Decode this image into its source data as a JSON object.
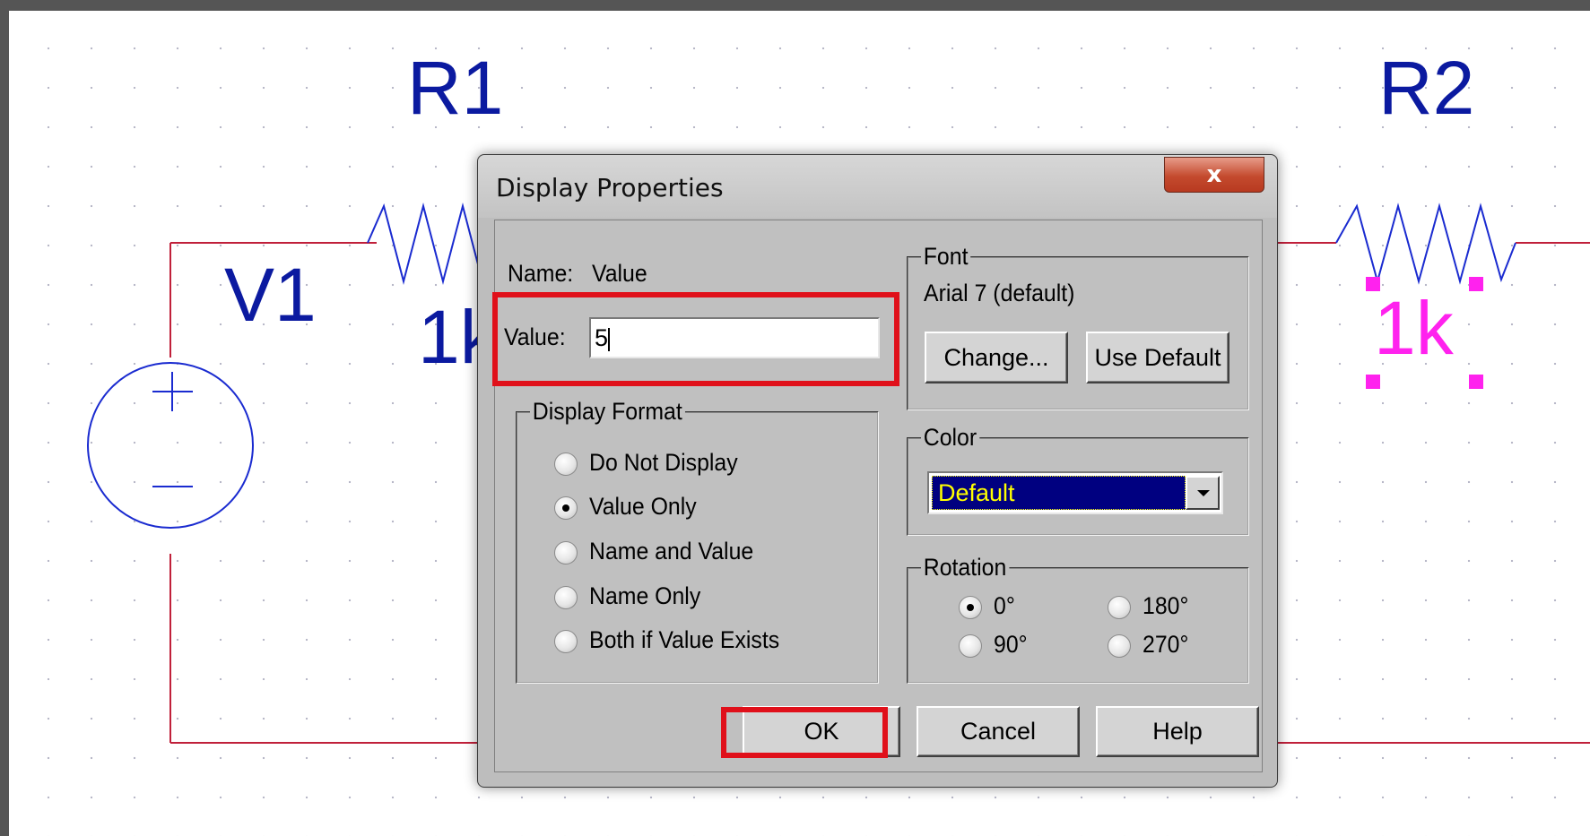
{
  "schematic": {
    "labels": {
      "r1": "R1",
      "r2": "R2",
      "v1": "V1",
      "r1_value": "1k",
      "r2_value": "1k"
    },
    "colors": {
      "wire": "#c0203a",
      "component": "#1a2bd0",
      "selected": "#ff22ee"
    }
  },
  "dialog": {
    "title": "Display Properties",
    "close_label": "x",
    "name_label": "Name:",
    "name_value": "Value",
    "value_label": "Value:",
    "value_input": "5",
    "display_format": {
      "legend": "Display Format",
      "options": [
        "Do Not Display",
        "Value Only",
        "Name and Value",
        "Name Only",
        "Both if Value Exists"
      ],
      "selected": "Value Only"
    },
    "font": {
      "legend": "Font",
      "current": "Arial 7 (default)",
      "change_label": "Change...",
      "default_label": "Use Default"
    },
    "color": {
      "legend": "Color",
      "selected": "Default"
    },
    "rotation": {
      "legend": "Rotation",
      "options": [
        "0°",
        "90°",
        "180°",
        "270°"
      ],
      "selected": "0°"
    },
    "buttons": {
      "ok": "OK",
      "cancel": "Cancel",
      "help": "Help"
    },
    "annotation_color": "#e0101a"
  }
}
